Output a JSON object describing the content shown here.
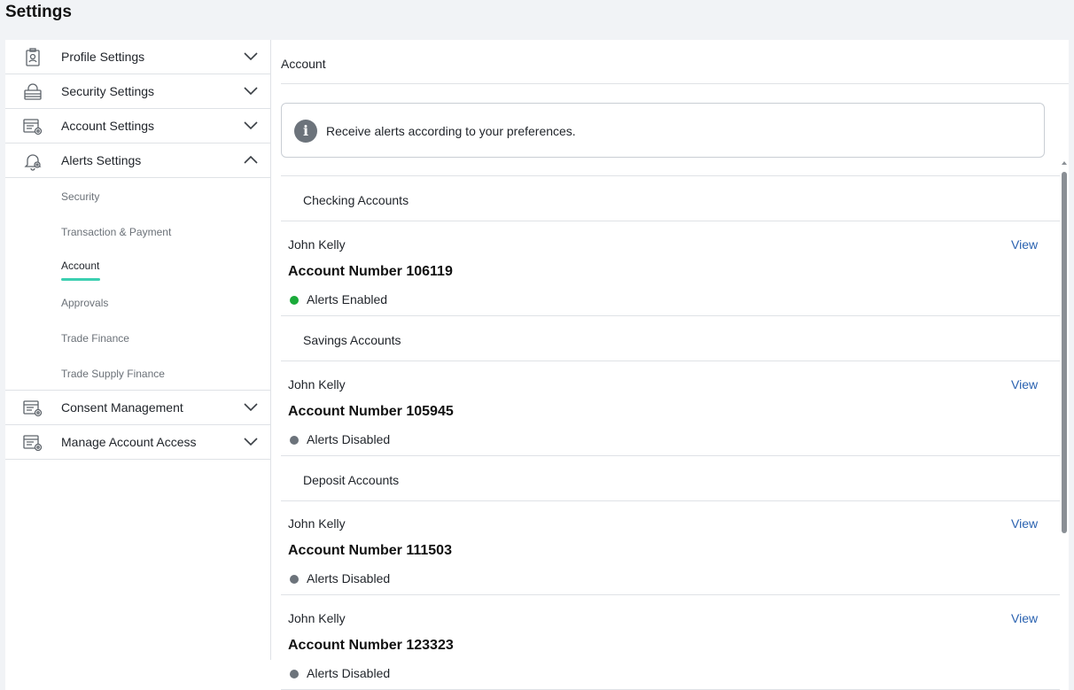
{
  "page": {
    "title": "Settings"
  },
  "sidebar": {
    "items": [
      {
        "label": "Profile Settings",
        "icon": "profile-badge-icon"
      },
      {
        "label": "Security Settings",
        "icon": "lock-icon"
      },
      {
        "label": "Account Settings",
        "icon": "account-gear-icon"
      },
      {
        "label": "Alerts Settings",
        "icon": "bell-icon",
        "expanded": true
      }
    ],
    "alerts_sub": [
      "Security",
      "Transaction & Payment",
      "Account",
      "Approvals",
      "Trade Finance",
      "Trade Supply Finance"
    ],
    "active_sub": "Account",
    "items_after": [
      {
        "label": "Consent Management",
        "icon": "account-gear-icon"
      },
      {
        "label": "Manage Account Access",
        "icon": "account-gear-icon"
      }
    ]
  },
  "main": {
    "header": "Account",
    "info": "Receive alerts according to your preferences.",
    "groups": [
      {
        "label": "Checking Accounts"
      },
      {
        "label": "Savings Accounts"
      },
      {
        "label": "Deposit Accounts"
      }
    ],
    "accounts": [
      {
        "owner": "John Kelly",
        "number": "Account Number 106119",
        "status": "Alerts Enabled",
        "view": "View"
      },
      {
        "owner": "John Kelly",
        "number": "Account Number 105945",
        "status": "Alerts Disabled",
        "view": "View"
      },
      {
        "owner": "John Kelly",
        "number": "Account Number 111503",
        "status": "Alerts Disabled",
        "view": "View"
      },
      {
        "owner": "John Kelly",
        "number": "Account Number 123323",
        "status": "Alerts Disabled",
        "view": "View"
      }
    ]
  },
  "colors": {
    "enabled": "#1aaa3a",
    "disabled": "#6c737b",
    "accent": "#3ccfb1",
    "link": "#2a62b0"
  }
}
